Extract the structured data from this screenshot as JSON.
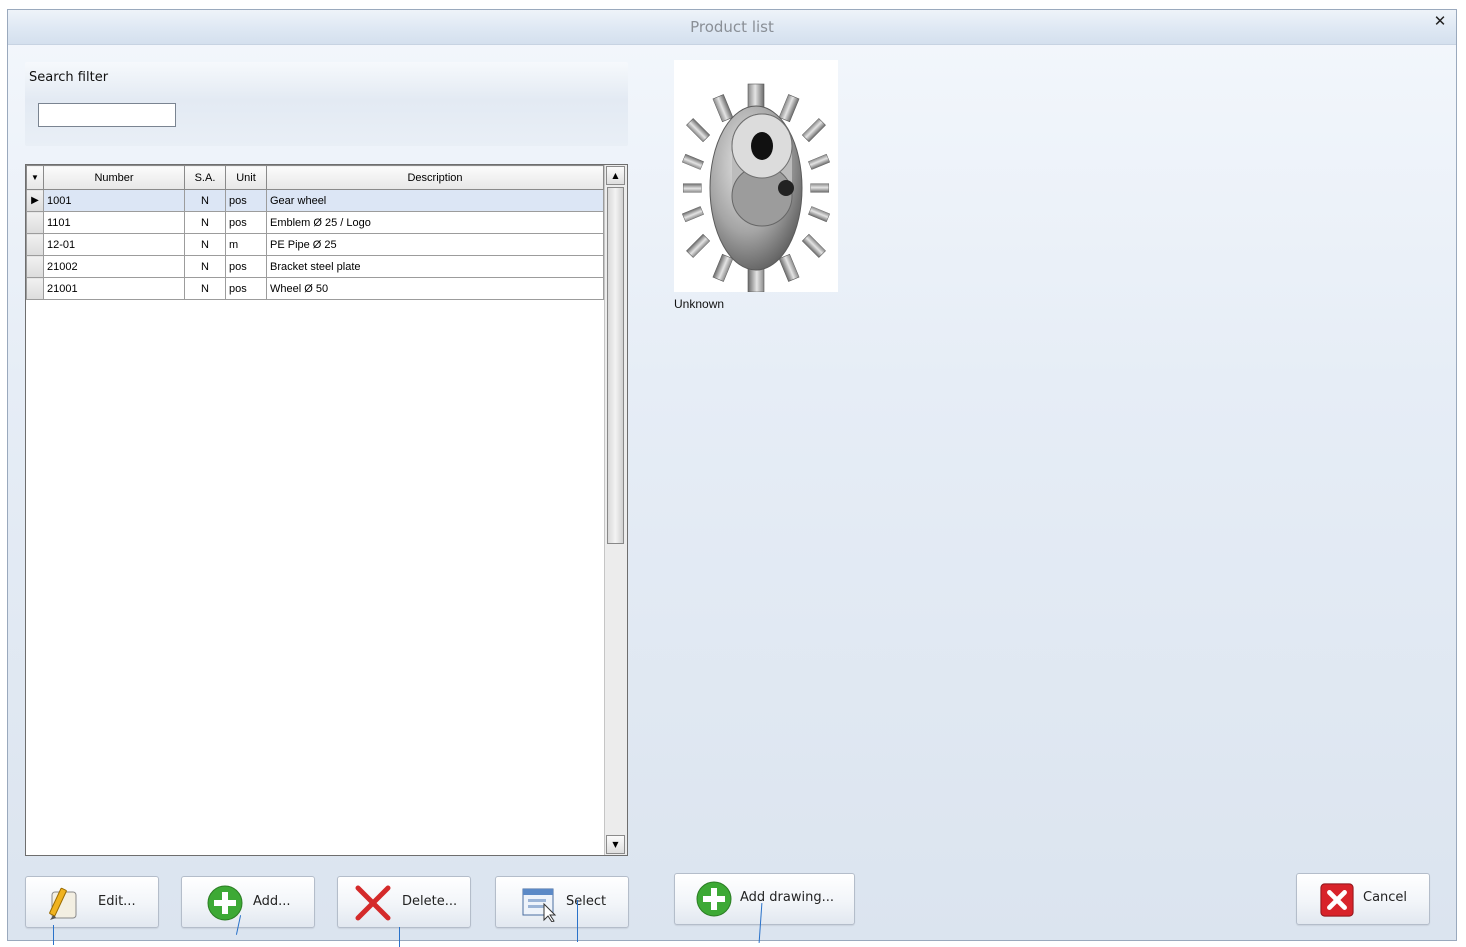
{
  "window": {
    "title": "Product list"
  },
  "filter": {
    "label": "Search filter",
    "value": "",
    "placeholder": ""
  },
  "table": {
    "columns": [
      "Number",
      "S.A.",
      "Unit",
      "Description"
    ],
    "rows": [
      {
        "number": "1001",
        "sa": "N",
        "unit": "pos",
        "description": "Gear wheel",
        "selected": true
      },
      {
        "number": "1101",
        "sa": "N",
        "unit": "pos",
        "description": "Emblem Ø 25 / Logo",
        "selected": false
      },
      {
        "number": "12-01",
        "sa": "N",
        "unit": "m",
        "description": "PE Pipe Ø 25",
        "selected": false
      },
      {
        "number": "21002",
        "sa": "N",
        "unit": "pos",
        "description": "Bracket steel plate",
        "selected": false
      },
      {
        "number": "21001",
        "sa": "N",
        "unit": "pos",
        "description": "Wheel Ø 50",
        "selected": false
      }
    ]
  },
  "image": {
    "caption": "Unknown",
    "icon": "gear-wheel-image"
  },
  "buttons": {
    "edit": "Edit...",
    "add": "Add...",
    "delete": "Delete...",
    "select": "Select",
    "add_drawing": "Add drawing...",
    "cancel": "Cancel"
  },
  "colors": {
    "selected_row": "#dce6f5",
    "add_green": "#3da935",
    "delete_red": "#d42a2a",
    "cancel_red": "#d8232a"
  }
}
